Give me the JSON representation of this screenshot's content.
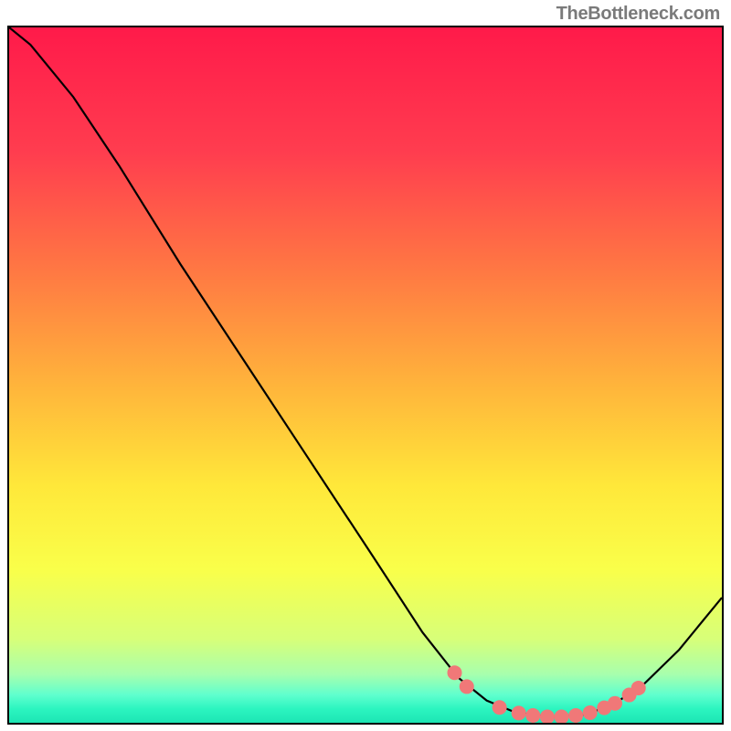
{
  "watermark": "TheBottleneck.com",
  "chart_data": {
    "type": "line",
    "title": "",
    "xlabel": "",
    "ylabel": "",
    "xlim": [
      0,
      100
    ],
    "ylim": [
      0,
      100
    ],
    "gradient": {
      "stops": [
        {
          "offset": 0,
          "color": "#ff1a4a"
        },
        {
          "offset": 18,
          "color": "#ff3d4f"
        },
        {
          "offset": 35,
          "color": "#ff7843"
        },
        {
          "offset": 52,
          "color": "#ffb63b"
        },
        {
          "offset": 66,
          "color": "#ffe83a"
        },
        {
          "offset": 78,
          "color": "#f9ff4a"
        },
        {
          "offset": 88,
          "color": "#d7ff79"
        },
        {
          "offset": 93,
          "color": "#a8ffad"
        },
        {
          "offset": 96,
          "color": "#5fffce"
        },
        {
          "offset": 98,
          "color": "#2cf5c0"
        },
        {
          "offset": 100,
          "color": "#1de5b4"
        }
      ]
    },
    "curve_points": [
      {
        "x": 0,
        "y": 100
      },
      {
        "x": 3,
        "y": 97.5
      },
      {
        "x": 9,
        "y": 90
      },
      {
        "x": 15.5,
        "y": 80
      },
      {
        "x": 24,
        "y": 66
      },
      {
        "x": 33,
        "y": 52
      },
      {
        "x": 42,
        "y": 38
      },
      {
        "x": 51,
        "y": 24
      },
      {
        "x": 58,
        "y": 13
      },
      {
        "x": 63,
        "y": 6.5
      },
      {
        "x": 67,
        "y": 3.2
      },
      {
        "x": 71,
        "y": 1.5
      },
      {
        "x": 76,
        "y": 0.8
      },
      {
        "x": 81,
        "y": 1.2
      },
      {
        "x": 85,
        "y": 2.8
      },
      {
        "x": 89,
        "y": 5.5
      },
      {
        "x": 94,
        "y": 10.5
      },
      {
        "x": 100,
        "y": 18
      }
    ],
    "markers": [
      {
        "x": 62.5,
        "y": 7.2
      },
      {
        "x": 64.2,
        "y": 5.2
      },
      {
        "x": 68.8,
        "y": 2.2
      },
      {
        "x": 71.5,
        "y": 1.4
      },
      {
        "x": 73.5,
        "y": 1.05
      },
      {
        "x": 75.5,
        "y": 0.85
      },
      {
        "x": 77.5,
        "y": 0.85
      },
      {
        "x": 79.5,
        "y": 1.05
      },
      {
        "x": 81.5,
        "y": 1.45
      },
      {
        "x": 83.5,
        "y": 2.15
      },
      {
        "x": 85.0,
        "y": 2.8
      },
      {
        "x": 87.0,
        "y": 4.0
      },
      {
        "x": 88.3,
        "y": 5.0
      }
    ],
    "marker_color": "#f07878",
    "marker_radius_px": 8
  }
}
